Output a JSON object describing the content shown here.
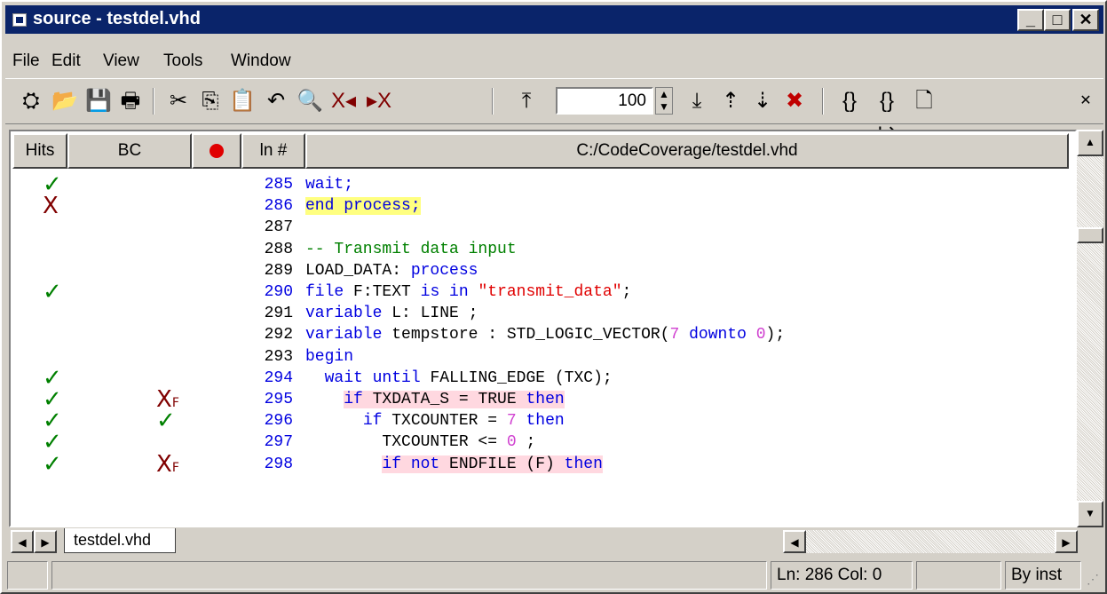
{
  "window": {
    "title": "source - testdel.vhd"
  },
  "menu": [
    "File",
    "Edit",
    "View",
    "Tools",
    "Window"
  ],
  "toolbar": {
    "zoom": "100"
  },
  "columns": {
    "hits": "Hits",
    "bc": "BC",
    "ln": "ln #",
    "file": "C:/CodeCoverage/testdel.vhd"
  },
  "lines": [
    {
      "num": "285",
      "hit": "check",
      "bc": "",
      "segments": [
        {
          "t": "wait;",
          "c": "kw"
        }
      ]
    },
    {
      "num": "286",
      "hit": "x",
      "bc": "",
      "segments": [
        {
          "t": "end process;",
          "c": "kw hy"
        }
      ]
    },
    {
      "num": "287",
      "hit": "",
      "bc": "",
      "segments": []
    },
    {
      "num": "288",
      "hit": "",
      "bc": "",
      "segments": [
        {
          "t": "-- Transmit data input",
          "c": "cm"
        }
      ]
    },
    {
      "num": "289",
      "hit": "",
      "bc": "",
      "segments": [
        {
          "t": "LOAD_DATA: ",
          "c": ""
        },
        {
          "t": "process",
          "c": "kw"
        }
      ]
    },
    {
      "num": "290",
      "hit": "check",
      "bc": "",
      "segments": [
        {
          "t": "file",
          "c": "kw"
        },
        {
          "t": " F:TEXT ",
          "c": ""
        },
        {
          "t": "is in",
          "c": "kw"
        },
        {
          "t": " ",
          "c": ""
        },
        {
          "t": "\"transmit_data\"",
          "c": "st"
        },
        {
          "t": ";",
          "c": ""
        }
      ]
    },
    {
      "num": "291",
      "hit": "",
      "bc": "",
      "segments": [
        {
          "t": "variable",
          "c": "kw"
        },
        {
          "t": " L: LINE ;",
          "c": ""
        }
      ]
    },
    {
      "num": "292",
      "hit": "",
      "bc": "",
      "segments": [
        {
          "t": "variable",
          "c": "kw"
        },
        {
          "t": " tempstore : STD_LOGIC_VECTOR(",
          "c": ""
        },
        {
          "t": "7",
          "c": "nm"
        },
        {
          "t": " downto ",
          "c": "kw"
        },
        {
          "t": "0",
          "c": "nm"
        },
        {
          "t": ");",
          "c": ""
        }
      ]
    },
    {
      "num": "293",
      "hit": "",
      "bc": "",
      "segments": [
        {
          "t": "begin",
          "c": "kw"
        }
      ]
    },
    {
      "num": "294",
      "hit": "check",
      "bc": "",
      "segments": [
        {
          "t": "  ",
          "c": ""
        },
        {
          "t": "wait until",
          "c": "kw"
        },
        {
          "t": " FALLING_EDGE (TXC);",
          "c": ""
        }
      ]
    },
    {
      "num": "295",
      "hit": "check",
      "bc": "xf",
      "segments": [
        {
          "t": "    ",
          "c": ""
        },
        {
          "t": "if",
          "c": "kw hp"
        },
        {
          "t": " TXDATA_S = TRUE ",
          "c": "hp"
        },
        {
          "t": "then",
          "c": "kw hp"
        }
      ]
    },
    {
      "num": "296",
      "hit": "check",
      "bc": "check",
      "segments": [
        {
          "t": "      ",
          "c": ""
        },
        {
          "t": "if",
          "c": "kw"
        },
        {
          "t": " TXCOUNTER = ",
          "c": ""
        },
        {
          "t": "7",
          "c": "nm"
        },
        {
          "t": " then",
          "c": "kw"
        }
      ]
    },
    {
      "num": "297",
      "hit": "check",
      "bc": "",
      "segments": [
        {
          "t": "        TXCOUNTER <= ",
          "c": ""
        },
        {
          "t": "0",
          "c": "nm"
        },
        {
          "t": " ;",
          "c": ""
        }
      ]
    },
    {
      "num": "298",
      "hit": "check",
      "bc": "xf",
      "segments": [
        {
          "t": "        ",
          "c": ""
        },
        {
          "t": "if not",
          "c": "kw hp"
        },
        {
          "t": " ENDFILE (F) ",
          "c": "hp"
        },
        {
          "t": "then",
          "c": "kw hp"
        }
      ]
    }
  ],
  "tab": {
    "label": "testdel.vhd"
  },
  "status": {
    "position": "Ln: 286  Col: 0",
    "mode": "By inst"
  }
}
